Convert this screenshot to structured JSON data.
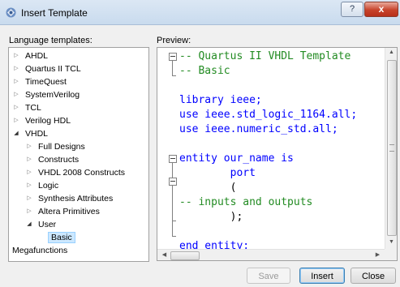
{
  "window": {
    "title": "Insert Template",
    "help_label": "?",
    "close_label": "x"
  },
  "labels": {
    "templates": "Language templates:",
    "preview": "Preview:"
  },
  "tree": [
    {
      "label": "AHDL",
      "state": "collapsed"
    },
    {
      "label": "Quartus II TCL",
      "state": "collapsed"
    },
    {
      "label": "TimeQuest",
      "state": "collapsed"
    },
    {
      "label": "SystemVerilog",
      "state": "collapsed"
    },
    {
      "label": "TCL",
      "state": "collapsed"
    },
    {
      "label": "Verilog HDL",
      "state": "collapsed"
    },
    {
      "label": "VHDL",
      "state": "expanded"
    },
    {
      "label": "Full Designs",
      "state": "collapsed"
    },
    {
      "label": "Constructs",
      "state": "collapsed"
    },
    {
      "label": "VHDL 2008 Constructs",
      "state": "collapsed"
    },
    {
      "label": "Logic",
      "state": "collapsed"
    },
    {
      "label": "Synthesis Attributes",
      "state": "collapsed"
    },
    {
      "label": "Altera Primitives",
      "state": "collapsed"
    },
    {
      "label": "User",
      "state": "expanded"
    },
    {
      "label": "Basic",
      "state": "selected"
    },
    {
      "label": "Megafunctions",
      "state": "leaf"
    }
  ],
  "code": [
    "-- Quartus II VHDL Template",
    "-- Basic",
    "",
    "library ieee;",
    "use ieee.std_logic_1164.all;",
    "use ieee.numeric_std.all;",
    "",
    "entity our_name is",
    "        port",
    "        (",
    "-- inputs and outputs",
    "        );",
    "",
    "end entity;"
  ],
  "colors": {
    "comment": "#228b22",
    "keyword": "#0000ff",
    "selection": "#cce8ff"
  },
  "buttons": {
    "save": "Save",
    "insert": "Insert",
    "close": "Close"
  }
}
